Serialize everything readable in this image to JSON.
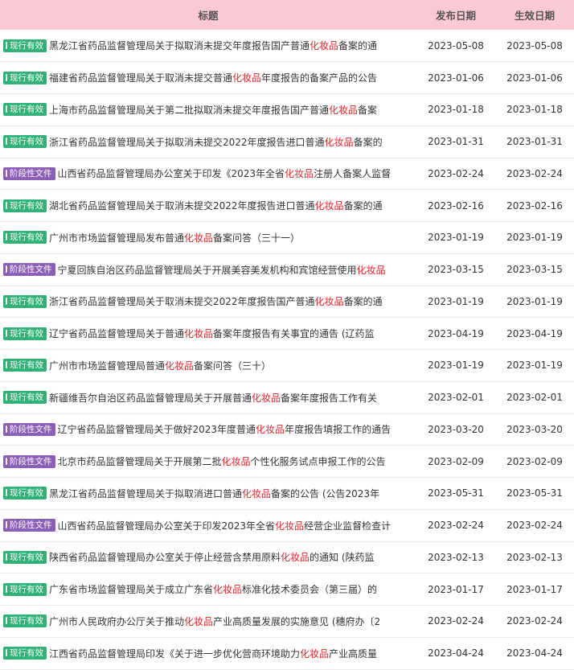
{
  "header": {
    "title": "标题",
    "publish_date": "发布日期",
    "effective_date": "生效日期"
  },
  "colors": {
    "header_bg": "#f9cad4",
    "status_current": "#2fb275",
    "status_phase": "#8b5fb8",
    "keyword": "#e8242b"
  },
  "rows": [
    {
      "status": "现行有效",
      "status_type": "current",
      "title_before": "黑龙江省药品监督管理局关于拟取消未提交年度报告国产普通",
      "keyword": "化妆品",
      "title_after": "备案的通",
      "publish_date": "2023-05-08",
      "effective_date": "2023-05-08"
    },
    {
      "status": "现行有效",
      "status_type": "current",
      "title_before": "福建省药品监督管理局关于取消未提交普通",
      "keyword": "化妆品",
      "title_after": "年度报告的备案产品的公告",
      "publish_date": "2023-01-06",
      "effective_date": "2023-01-06"
    },
    {
      "status": "现行有效",
      "status_type": "current",
      "title_before": "上海市药品监督管理局关于第二批拟取消未提交年度报告国产普通",
      "keyword": "化妆品",
      "title_after": "备案",
      "publish_date": "2023-01-18",
      "effective_date": "2023-01-18"
    },
    {
      "status": "现行有效",
      "status_type": "current",
      "title_before": "浙江省药品监督管理局关于拟取消未提交2022年度报告进口普通",
      "keyword": "化妆品",
      "title_after": "备案的",
      "publish_date": "2023-01-31",
      "effective_date": "2023-01-31"
    },
    {
      "status": "阶段性文件",
      "status_type": "phase",
      "title_before": "山西省药品监督管理局办公室关于印发《2023年全省",
      "keyword": "化妆品",
      "title_after": "注册人备案人监督",
      "publish_date": "2023-02-24",
      "effective_date": "2023-02-24"
    },
    {
      "status": "现行有效",
      "status_type": "current",
      "title_before": "湖北省药品监督管理局关于取消未提交2022年度报告进口普通",
      "keyword": "化妆品",
      "title_after": "备案的通",
      "publish_date": "2023-02-16",
      "effective_date": "2023-02-16"
    },
    {
      "status": "现行有效",
      "status_type": "current",
      "title_before": "广州市市场监督管理局发布普通",
      "keyword": "化妆品",
      "title_after": "备案问答（三十一）",
      "publish_date": "2023-01-19",
      "effective_date": "2023-01-19"
    },
    {
      "status": "阶段性文件",
      "status_type": "phase",
      "title_before": "宁夏回族自治区药品监督管理局关于开展美容美发机构和宾馆经营使用",
      "keyword": "化妆品",
      "title_after": "",
      "publish_date": "2023-03-15",
      "effective_date": "2023-03-15"
    },
    {
      "status": "现行有效",
      "status_type": "current",
      "title_before": "浙江省药品监督管理局关于取消未提交2022年度报告国产普通",
      "keyword": "化妆品",
      "title_after": "备案的通",
      "publish_date": "2023-01-19",
      "effective_date": "2023-01-19"
    },
    {
      "status": "现行有效",
      "status_type": "current",
      "title_before": "辽宁省药品监督管理局关于普通",
      "keyword": "化妆品",
      "title_after": "备案年度报告有关事宜的通告 (辽药监",
      "publish_date": "2023-04-19",
      "effective_date": "2023-04-19"
    },
    {
      "status": "现行有效",
      "status_type": "current",
      "title_before": "广州市市场监督管理局普通",
      "keyword": "化妆品",
      "title_after": "备案问答（三十）",
      "publish_date": "2023-01-19",
      "effective_date": "2023-01-19"
    },
    {
      "status": "现行有效",
      "status_type": "current",
      "title_before": "新疆维吾尔自治区药品监督管理局关于开展普通",
      "keyword": "化妆品",
      "title_after": "备案年度报告工作有关",
      "publish_date": "2023-02-01",
      "effective_date": "2023-02-01"
    },
    {
      "status": "阶段性文件",
      "status_type": "phase",
      "title_before": "辽宁省药品监督管理局关于做好2023年度普通",
      "keyword": "化妆品",
      "title_after": "年度报告填报工作的通告",
      "publish_date": "2023-03-20",
      "effective_date": "2023-03-20"
    },
    {
      "status": "阶段性文件",
      "status_type": "phase",
      "title_before": "北京市药品监督管理局关于开展第二批",
      "keyword": "化妆品",
      "title_after": "个性化服务试点申报工作的公告",
      "publish_date": "2023-02-09",
      "effective_date": "2023-02-09"
    },
    {
      "status": "现行有效",
      "status_type": "current",
      "title_before": "黑龙江省药品监督管理局关于拟取消进口普通",
      "keyword": "化妆品",
      "title_after": "备案的公告 (公告2023年",
      "publish_date": "2023-05-31",
      "effective_date": "2023-05-31"
    },
    {
      "status": "阶段性文件",
      "status_type": "phase",
      "title_before": "山西省药品监督管理局办公室关于印发2023年全省",
      "keyword": "化妆品",
      "title_after": "经营企业监督检查计",
      "publish_date": "2023-02-24",
      "effective_date": "2023-02-24"
    },
    {
      "status": "现行有效",
      "status_type": "current",
      "title_before": "陕西省药品监督管理局办公室关于停止经营含禁用原料",
      "keyword": "化妆品",
      "title_after": "的通知 (陕药监",
      "publish_date": "2023-02-13",
      "effective_date": "2023-02-13"
    },
    {
      "status": "现行有效",
      "status_type": "current",
      "title_before": "广东省市场监督管理局关于成立广东省",
      "keyword": "化妆品",
      "title_after": "标准化技术委员会（第三届）的",
      "publish_date": "2023-01-17",
      "effective_date": "2023-01-17"
    },
    {
      "status": "现行有效",
      "status_type": "current",
      "title_before": "广州市人民政府办公厅关于推动",
      "keyword": "化妆品",
      "title_after": "产业高质量发展的实施意见 (穗府办〔2",
      "publish_date": "2023-02-24",
      "effective_date": "2023-02-24"
    },
    {
      "status": "现行有效",
      "status_type": "current",
      "title_before": "江西省药品监督管理局印发《关于进一步优化营商环境助力",
      "keyword": "化妆品",
      "title_after": "产业高质量",
      "publish_date": "2023-04-24",
      "effective_date": "2023-04-24"
    }
  ]
}
